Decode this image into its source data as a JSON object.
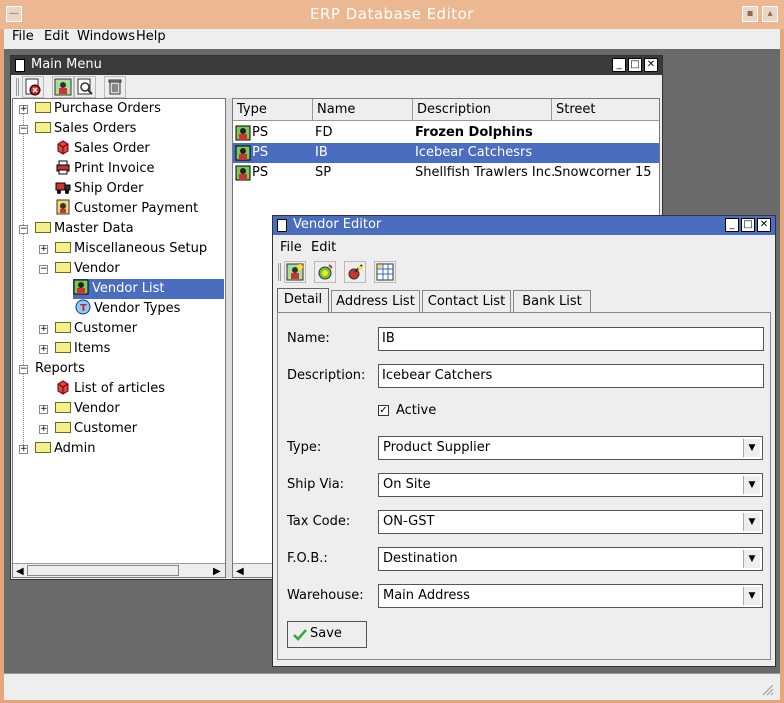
{
  "app": {
    "title": "ERP Database Editor"
  },
  "menubar": {
    "items": [
      "File",
      "Edit",
      "Windows",
      "Help"
    ]
  },
  "main_menu": {
    "title": "Main Menu",
    "tree": {
      "purchase_orders": "Purchase Orders",
      "sales_orders": "Sales Orders",
      "sales_order": "Sales Order",
      "print_invoice": "Print Invoice",
      "ship_order": "Ship Order",
      "customer_payment": "Customer Payment",
      "master_data": "Master Data",
      "misc_setup": "Miscellaneous Setup",
      "vendor": "Vendor",
      "vendor_list": "Vendor List",
      "vendor_types": "Vendor Types",
      "customer": "Customer",
      "items": "Items",
      "reports": "Reports",
      "list_of_articles": "List of articles",
      "reports_vendor": "Vendor",
      "reports_customer": "Customer",
      "admin": "Admin"
    },
    "table": {
      "columns": [
        "Type",
        "Name",
        "Description",
        "Street"
      ],
      "rows": [
        {
          "type": "PS",
          "name": "FD",
          "description": "Frozen Dolphins",
          "street": ""
        },
        {
          "type": "PS",
          "name": "IB",
          "description": "Icebear Catchesrs",
          "street": ""
        },
        {
          "type": "PS",
          "name": "SP",
          "description": "Shellfish Trawlers Inc.",
          "street": "Snowcorner 15"
        }
      ]
    }
  },
  "vendor_editor": {
    "title": "Vendor Editor",
    "menu": [
      "File",
      "Edit"
    ],
    "tabs": [
      "Detail",
      "Address List",
      "Contact List",
      "Bank List"
    ],
    "fields": {
      "name_label": "Name:",
      "name_value": "IB",
      "description_label": "Description:",
      "description_value": "Icebear Catchers",
      "active_label": "Active",
      "type_label": "Type:",
      "type_value": "Product Supplier",
      "ship_via_label": "Ship Via:",
      "ship_via_value": "On Site",
      "tax_code_label": "Tax Code:",
      "tax_code_value": "ON-GST",
      "fob_label": "F.O.B.:",
      "fob_value": "Destination",
      "warehouse_label": "Warehouse:",
      "warehouse_value": "Main Address"
    },
    "save_label": "Save"
  },
  "colors": {
    "selection": "#4a6dbf",
    "desktop": "#6a6a6a",
    "frame": "#e4a77b"
  }
}
